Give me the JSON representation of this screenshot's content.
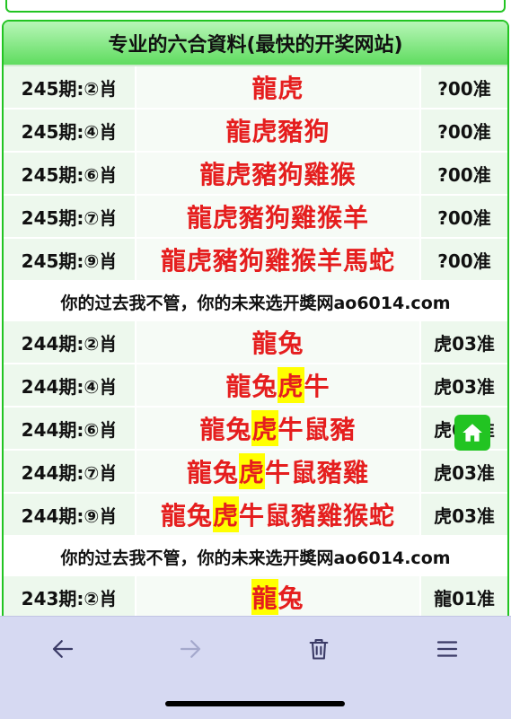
{
  "header": {
    "title": "专业的六合資料(最快的开奖网站)"
  },
  "rows": [
    {
      "period": "245期:②肖",
      "zodiac_main": "龍虎",
      "zodiac_hl": "",
      "zodiac_rest": "",
      "result": "?00准"
    },
    {
      "period": "245期:④肖",
      "zodiac_main": "龍虎豬狗",
      "zodiac_hl": "",
      "zodiac_rest": "",
      "result": "?00准"
    },
    {
      "period": "245期:⑥肖",
      "zodiac_main": "龍虎豬狗雞猴",
      "zodiac_hl": "",
      "zodiac_rest": "",
      "result": "?00准"
    },
    {
      "period": "245期:⑦肖",
      "zodiac_main": "龍虎豬狗雞猴羊",
      "zodiac_hl": "",
      "zodiac_rest": "",
      "result": "?00准"
    },
    {
      "period": "245期:⑨肖",
      "zodiac_main": "龍虎豬狗雞猴羊馬蛇",
      "zodiac_hl": "",
      "zodiac_rest": "",
      "result": "?00准"
    },
    {
      "slogan": "你的过去我不管，你的未来选开奬网ao6014.com"
    },
    {
      "period": "244期:②肖",
      "zodiac_main": "龍兔",
      "zodiac_hl": "",
      "zodiac_rest": "",
      "result": "虎03准"
    },
    {
      "period": "244期:④肖",
      "zodiac_main": "龍兔",
      "zodiac_hl": "虎",
      "zodiac_rest": "牛",
      "result": "虎03准"
    },
    {
      "period": "244期:⑥肖",
      "zodiac_main": "龍兔",
      "zodiac_hl": "虎",
      "zodiac_rest": "牛鼠豬",
      "result": "虎03准"
    },
    {
      "period": "244期:⑦肖",
      "zodiac_main": "龍兔",
      "zodiac_hl": "虎",
      "zodiac_rest": "牛鼠豬雞",
      "result": "虎03准"
    },
    {
      "period": "244期:⑨肖",
      "zodiac_main": "龍兔",
      "zodiac_hl": "虎",
      "zodiac_rest": "牛鼠豬雞猴蛇",
      "result": "虎03准"
    },
    {
      "slogan": "你的过去我不管，你的未来选开奬网ao6014.com"
    },
    {
      "period": "243期:②肖",
      "zodiac_main": "",
      "zodiac_hl": "龍",
      "zodiac_rest": "兔",
      "result": "龍01准"
    }
  ],
  "icons": {
    "home": "home-icon",
    "back": "arrow-left-icon",
    "forward": "arrow-right-icon",
    "trash": "trash-icon",
    "menu": "menu-icon"
  },
  "colors": {
    "accent": "#22c422",
    "zodiac_text": "#e51e1e",
    "highlight": "#ffff00",
    "browser_bar": "#d6d9f2"
  }
}
